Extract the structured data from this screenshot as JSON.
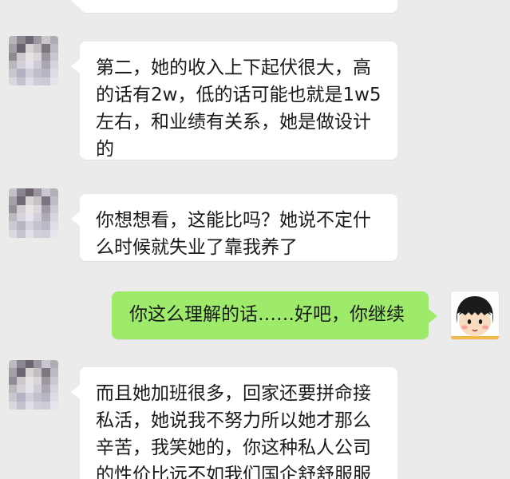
{
  "chat": {
    "messages": [
      {
        "id": "m0",
        "side": "left",
        "lines": [
          ""
        ]
      },
      {
        "id": "m1",
        "side": "left",
        "lines": [
          "第二，她的收入上下起伏很大，高",
          "的话有2w，低的话可能也就是1w5",
          "左右，和业绩有关系，她是做设计",
          "的"
        ]
      },
      {
        "id": "m2",
        "side": "left",
        "lines": [
          "你想想看，这能比吗？她说不定什",
          "么时候就失业了靠我养了"
        ]
      },
      {
        "id": "m3",
        "side": "right",
        "lines": [
          "你这么理解的话……好吧，你继续"
        ]
      },
      {
        "id": "m4",
        "side": "left",
        "lines": [
          "而且她加班很多，回家还要拼命接",
          "私活，她说我不努力所以她才那么",
          "辛苦，我笑她的，你这种私人公司",
          "的性价比远不如我们国企舒舒服服"
        ]
      }
    ]
  },
  "colors": {
    "background": "#ebebeb",
    "incoming_bubble": "#ffffff",
    "outgoing_bubble": "#9eea6a",
    "text": "#1a1a1a"
  },
  "icons": {
    "contact_avatar": "pixelated-avatar-icon",
    "self_avatar": "cartoon-girl-avatar-icon"
  }
}
